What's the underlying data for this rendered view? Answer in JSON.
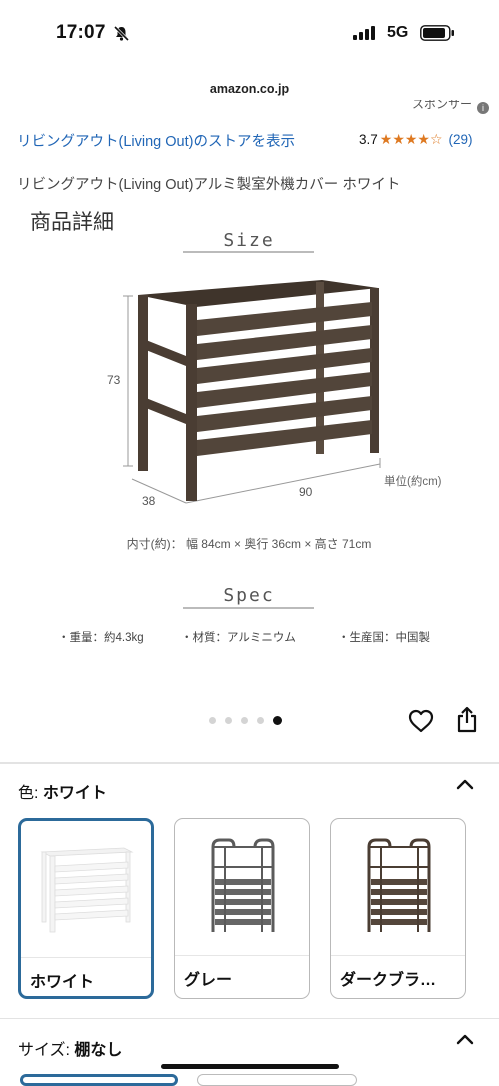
{
  "status_bar": {
    "time": "17:07",
    "network": "5G"
  },
  "browser": {
    "url": "amazon.co.jp"
  },
  "header": {
    "sponsored": "スポンサー"
  },
  "product": {
    "store_link": "リビングアウト(Living Out)のストアを表示",
    "rating": "3.7",
    "stars": "★★★★☆",
    "review_count": "(29)",
    "title": "リビングアウト(Living Out)アルミ製室外機カバー ホワイト"
  },
  "image": {
    "heading": "商品詳細",
    "size_title": "Size",
    "dim_height": "73",
    "dim_depth": "38",
    "dim_width": "90",
    "unit": "単位(約cm)",
    "inner_dims": "内寸(約)： 幅 84cm × 奥行 36cm × 高さ 71cm",
    "spec_title": "Spec",
    "spec_weight": "・重量：約4.3kg",
    "spec_material": "・材質：アルミニウム",
    "spec_origin": "・生産国：中国製",
    "carousel_total": 5,
    "carousel_active": 5
  },
  "color": {
    "label": "色:",
    "selected": "ホワイト",
    "options": [
      {
        "label": "ホワイト",
        "selected": true
      },
      {
        "label": "グレー",
        "selected": false
      },
      {
        "label": "ダークブラ…",
        "selected": false
      }
    ]
  },
  "size": {
    "label": "サイズ:",
    "selected": "棚なし"
  },
  "colors": {
    "accent": "#2c6a9a",
    "link": "#2166b6",
    "star": "#de7921",
    "frame_brown": "#4a3d33"
  },
  "icons": [
    "silent-bell-icon",
    "signal-icon",
    "battery-icon",
    "info-icon",
    "heart-icon",
    "share-icon",
    "chevron-up-icon"
  ]
}
